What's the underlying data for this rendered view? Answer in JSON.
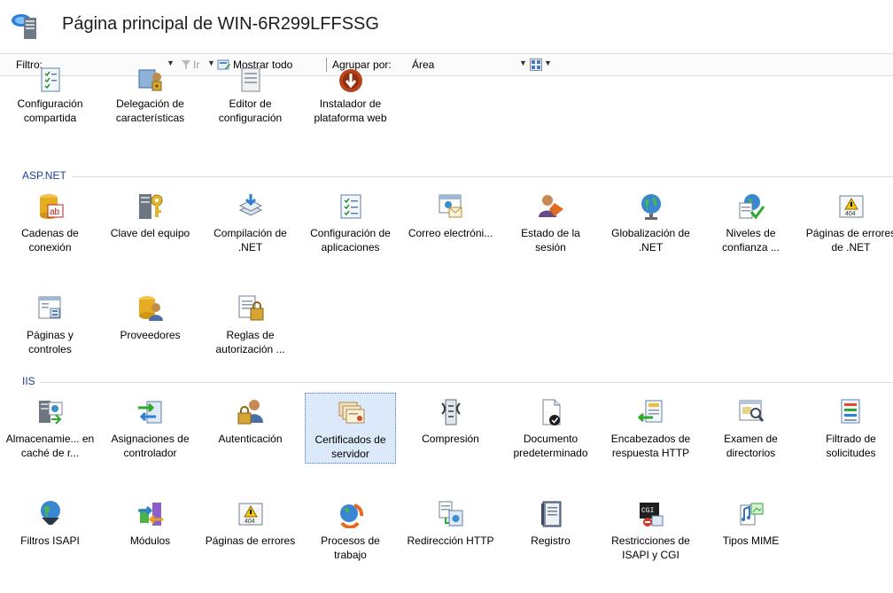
{
  "header": {
    "title": "Página principal de WIN-6R299LFFSSG"
  },
  "toolbar": {
    "filter_label": "Filtro:",
    "go_label": "Ir",
    "show_all_label": "Mostrar todo",
    "group_by_label": "Agrupar por:",
    "group_by_value": "Área"
  },
  "top_items": [
    {
      "label": "Configuración compartida",
      "icon": "shared-config-icon"
    },
    {
      "label": "Delegación de características",
      "icon": "feature-delegation-icon"
    },
    {
      "label": "Editor de configuración",
      "icon": "config-editor-icon"
    },
    {
      "label": "Instalador de plataforma web",
      "icon": "web-platform-installer-icon"
    }
  ],
  "groups": [
    {
      "title": "ASP.NET",
      "items": [
        {
          "label": "Cadenas de conexión",
          "icon": "connection-strings-icon"
        },
        {
          "label": "Clave del equipo",
          "icon": "machine-key-icon"
        },
        {
          "label": "Compilación de .NET",
          "icon": "net-compilation-icon"
        },
        {
          "label": "Configuración de aplicaciones",
          "icon": "app-settings-icon"
        },
        {
          "label": "Correo electróni...",
          "icon": "smtp-email-icon"
        },
        {
          "label": "Estado de la sesión",
          "icon": "session-state-icon"
        },
        {
          "label": "Globalización de .NET",
          "icon": "net-globalization-icon"
        },
        {
          "label": "Niveles de confianza ...",
          "icon": "trust-levels-icon"
        },
        {
          "label": "Páginas de errores de .NET",
          "icon": "net-error-pages-icon"
        },
        {
          "label": "Páginas y controles",
          "icon": "pages-controls-icon"
        },
        {
          "label": "Proveedores",
          "icon": "providers-icon"
        },
        {
          "label": "Reglas de autorización ...",
          "icon": "authorization-rules-icon"
        }
      ]
    },
    {
      "title": "IIS",
      "items": [
        {
          "label": "Almacenamie... en caché de r...",
          "icon": "output-caching-icon"
        },
        {
          "label": "Asignaciones de controlador",
          "icon": "handler-mappings-icon"
        },
        {
          "label": "Autenticación",
          "icon": "authentication-icon"
        },
        {
          "label": "Certificados de servidor",
          "icon": "server-certificates-icon",
          "selected": true
        },
        {
          "label": "Compresión",
          "icon": "compression-icon"
        },
        {
          "label": "Documento predeterminado",
          "icon": "default-document-icon"
        },
        {
          "label": "Encabezados de respuesta HTTP",
          "icon": "http-response-headers-icon"
        },
        {
          "label": "Examen de directorios",
          "icon": "directory-browsing-icon"
        },
        {
          "label": "Filtrado de solicitudes",
          "icon": "request-filtering-icon"
        },
        {
          "label": "Filtros ISAPI",
          "icon": "isapi-filters-icon"
        },
        {
          "label": "Módulos",
          "icon": "modules-icon"
        },
        {
          "label": "Páginas de errores",
          "icon": "error-pages-icon"
        },
        {
          "label": "Procesos de trabajo",
          "icon": "worker-processes-icon"
        },
        {
          "label": "Redirección HTTP",
          "icon": "http-redirect-icon"
        },
        {
          "label": "Registro",
          "icon": "logging-icon"
        },
        {
          "label": "Restricciones de ISAPI y CGI",
          "icon": "isapi-cgi-restrictions-icon"
        },
        {
          "label": "Tipos MIME",
          "icon": "mime-types-icon"
        }
      ]
    }
  ],
  "colors": {
    "group_title": "#1f3f8f",
    "selection": "#dbe9fb",
    "selection_border": "#3a78c9"
  }
}
